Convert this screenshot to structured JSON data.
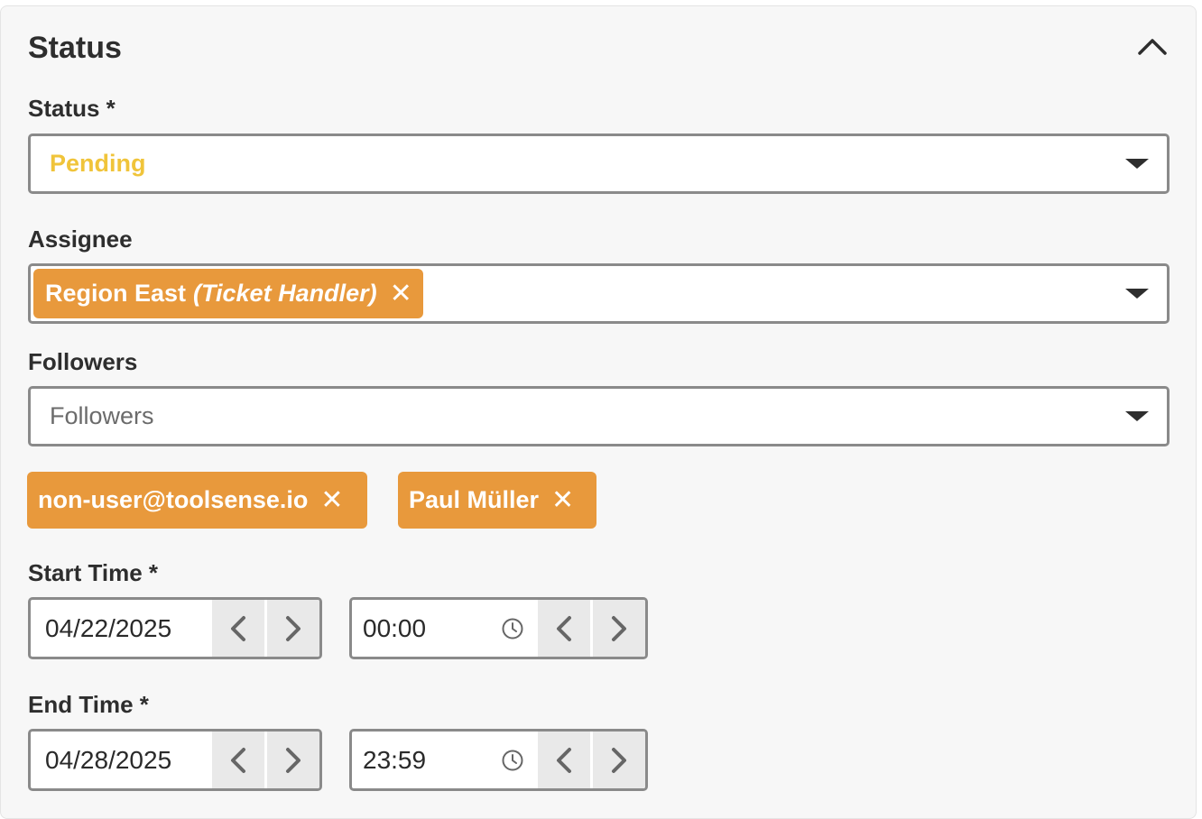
{
  "panel": {
    "title": "Status",
    "collapse_icon": "chevron-up-icon"
  },
  "status_field": {
    "label": "Status *",
    "value": "Pending",
    "value_color": "#f0c43a"
  },
  "assignee_field": {
    "label": "Assignee",
    "chip": {
      "name": "Region East",
      "role": "(Ticket Handler)",
      "remove_icon": "close-icon"
    }
  },
  "followers_field": {
    "label": "Followers",
    "placeholder": "Followers",
    "chips": [
      {
        "label": "non-user@toolsense.io",
        "remove_icon": "close-icon"
      },
      {
        "label": "Paul Müller",
        "remove_icon": "close-icon"
      }
    ]
  },
  "start_time": {
    "label": "Start Time *",
    "date": "04/22/2025",
    "time": "00:00"
  },
  "end_time": {
    "label": "End Time *",
    "date": "04/28/2025",
    "time": "23:59"
  },
  "colors": {
    "chip_bg": "#e8993c",
    "border": "#8a8a8a"
  },
  "icons": {
    "dropdown": "caret-down-icon",
    "prev": "chevron-left-icon",
    "next": "chevron-right-icon",
    "clock": "clock-icon"
  }
}
